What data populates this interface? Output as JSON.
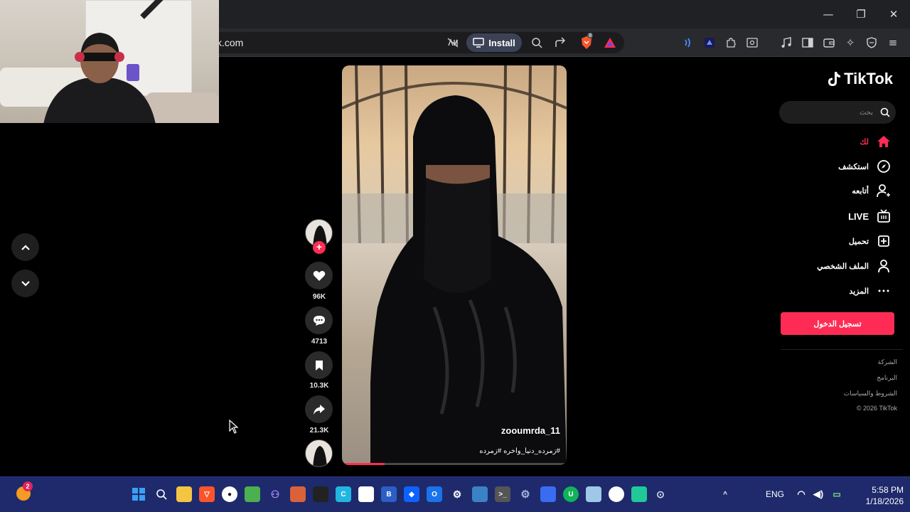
{
  "browser": {
    "url_text": "k.com",
    "install_label": "Install",
    "brave_badge": "8",
    "window_controls": [
      "minimize",
      "restore",
      "close"
    ]
  },
  "tiktok": {
    "logo_text": "TikTok",
    "search_placeholder": "بحث",
    "nav": [
      {
        "label": "لك",
        "icon": "home-icon",
        "active": true
      },
      {
        "label": "استكشف",
        "icon": "compass-icon"
      },
      {
        "label": "أتابعه",
        "icon": "following-icon"
      },
      {
        "label": "LIVE",
        "icon": "live-icon"
      },
      {
        "label": "تحميل",
        "icon": "upload-icon"
      },
      {
        "label": "الملف الشخصي",
        "icon": "profile-icon"
      },
      {
        "label": "المزيد",
        "icon": "more-icon"
      }
    ],
    "login_label": "تسجيل الدخول",
    "footer_links": [
      "الشركة",
      "البرنامج",
      "الشروط والسياسات",
      "© 2026 TikTok"
    ],
    "accent_color": "#fe2c55"
  },
  "video": {
    "username": "zooumrda_11",
    "caption": "#زمرده_دنيا_واخره #زمرده",
    "progress": 0.19
  },
  "actions": {
    "likes": "96K",
    "comments": "4713",
    "saves": "10.3K",
    "shares": "21.3K"
  },
  "taskbar": {
    "language": "ENG",
    "time": "5:58 PM",
    "date": "1/18/2026",
    "notification_badge": "2"
  }
}
